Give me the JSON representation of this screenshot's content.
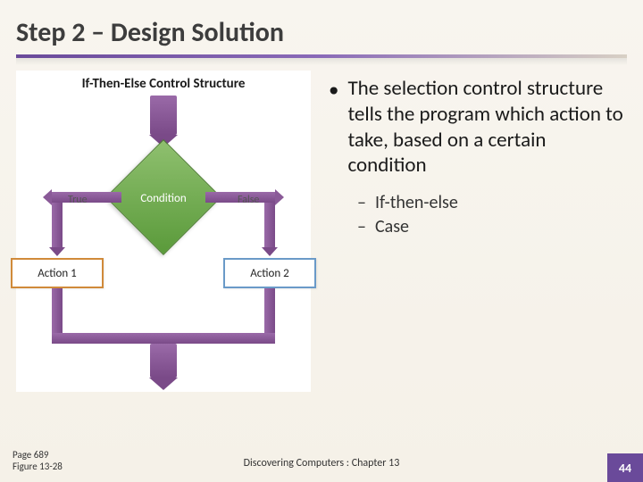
{
  "title": "Step 2 – Design Solution",
  "diagram": {
    "heading": "If-Then-Else Control Structure",
    "condition": "Condition",
    "true_label": "True",
    "false_label": "False",
    "action1": "Action 1",
    "action2": "Action 2"
  },
  "body": {
    "main_bullet": "The selection control structure tells the program which action to take, based on a certain condition",
    "sub_bullets": [
      "If-then-else",
      "Case"
    ]
  },
  "footer": {
    "page_ref_line1": "Page 689",
    "page_ref_line2": "Figure 13-28",
    "center": "Discovering Computers : Chapter 13",
    "slide_number": "44"
  }
}
